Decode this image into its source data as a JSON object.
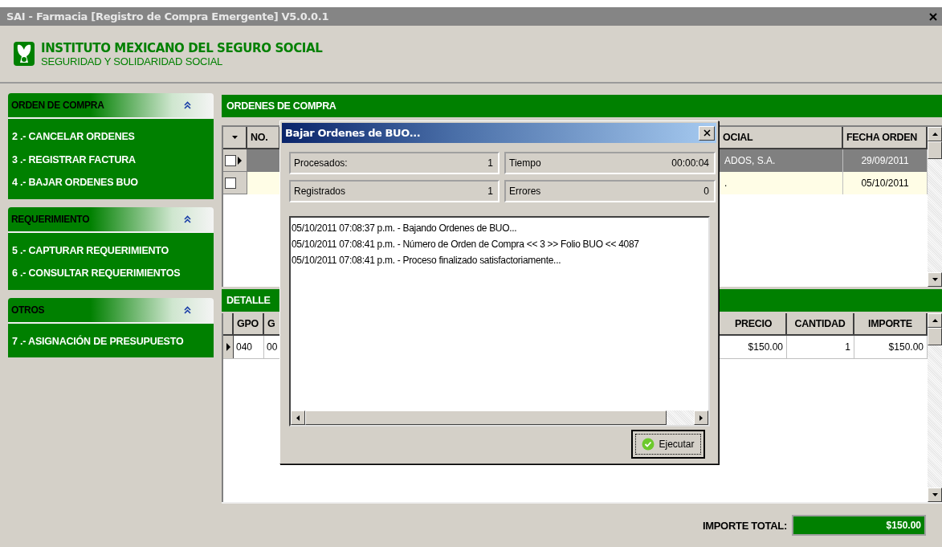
{
  "window": {
    "title": "SAI - Farmacia [Registro de Compra Emergente] V5.0.0.1"
  },
  "header": {
    "title": "INSTITUTO MEXICANO DEL SEGURO SOCIAL",
    "subtitle": "SEGURIDAD Y SOLIDARIDAD SOCIAL"
  },
  "sidebar": {
    "groups": [
      {
        "title": "ORDEN DE COMPRA",
        "expanded": true,
        "items": [
          {
            "label": "2 .- CANCELAR ORDENES"
          },
          {
            "label": "3 .- REGISTRAR FACTURA"
          },
          {
            "label": "4 .- BAJAR ORDENES BUO"
          }
        ]
      },
      {
        "title": "REQUERIMIENTO",
        "expanded": true,
        "items": [
          {
            "label": "5 .- CAPTURAR REQUERIMIENTO"
          },
          {
            "label": "6 .- CONSULTAR REQUERIMIENTOS"
          }
        ]
      },
      {
        "title": "OTROS",
        "expanded": true,
        "items": [
          {
            "label": "7 .- ASIGNACIÓN DE PRESUPUESTO"
          }
        ]
      }
    ]
  },
  "orders": {
    "title": "ORDENES DE COMPRA",
    "columns": [
      "NO.",
      "OCIAL",
      "FECHA ORDEN"
    ],
    "rows": [
      {
        "selected": true,
        "current": true,
        "checked": false,
        "cells": [
          "",
          "ADOS, S.A.",
          "29/09/2011"
        ]
      },
      {
        "selected": false,
        "current": false,
        "checked": false,
        "cells": [
          "",
          ".",
          "05/10/2011"
        ]
      }
    ]
  },
  "details": {
    "title": "DETALLE",
    "columns": [
      "GPO",
      "G",
      "PRECIO",
      "CANTIDAD",
      "IMPORTE"
    ],
    "rows": [
      {
        "current": true,
        "cells": [
          "040",
          "00",
          "$150.00",
          "1",
          "$150.00"
        ]
      }
    ]
  },
  "total": {
    "label": "IMPORTE TOTAL:",
    "value": "$150.00"
  },
  "dialog": {
    "title": "Bajar Ordenes de BUO...",
    "stats": [
      {
        "label": "Procesados:",
        "value": "1"
      },
      {
        "label": "Tiempo",
        "value": "00:00:04"
      },
      {
        "label": "Registrados",
        "value": "1"
      },
      {
        "label": "Errores",
        "value": "0"
      }
    ],
    "log": [
      "05/10/2011 07:08:37 p.m. - Bajando Ordenes de BUO...",
      "05/10/2011 07:08:41 p.m. - Número de Orden de Compra << 3 >> Folio BUO << 4087",
      "05/10/2011 07:08:41 p.m. - Proceso finalizado satisfactoriamente..."
    ],
    "button": "Ejecutar"
  }
}
